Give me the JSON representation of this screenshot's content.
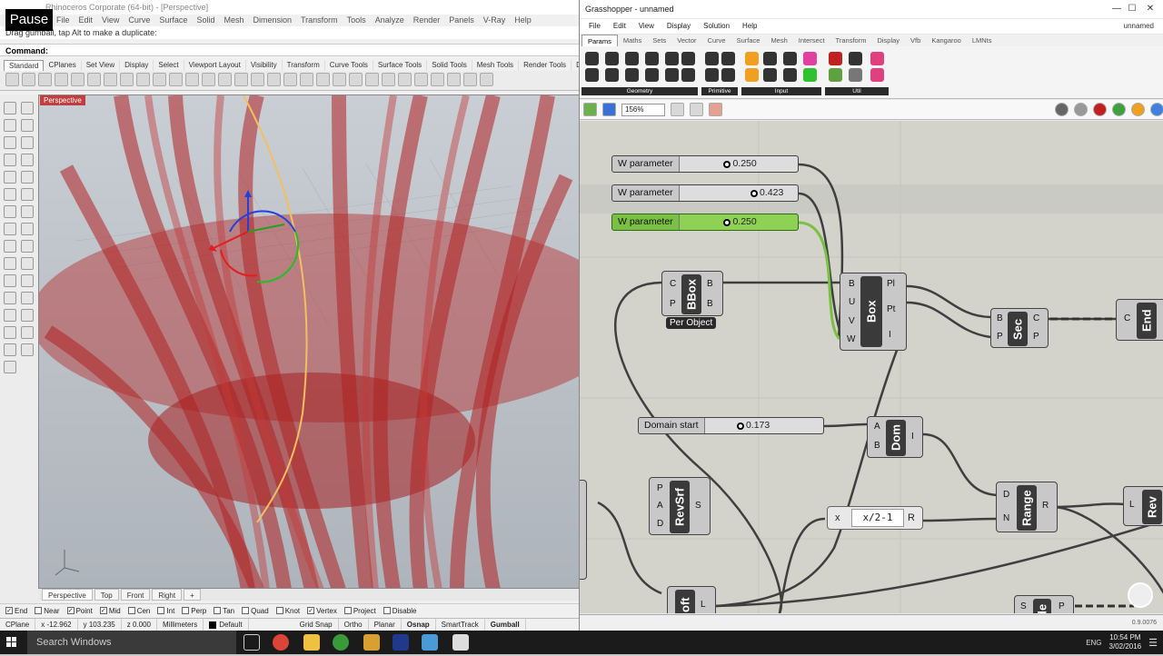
{
  "rhino": {
    "title": "Rhinoceros Corporate (64-bit) - [Perspective]",
    "pause_label": "Pause",
    "menu": [
      "File",
      "Edit",
      "View",
      "Curve",
      "Surface",
      "Solid",
      "Mesh",
      "Dimension",
      "Transform",
      "Tools",
      "Analyze",
      "Render",
      "Panels",
      "V-Ray",
      "Help"
    ],
    "prompt_text": "Drag gumball, tap Alt to make a duplicate:",
    "command_label": "Command:",
    "toolbar_tabs": [
      "Standard",
      "CPlanes",
      "Set View",
      "Display",
      "Select",
      "Viewport Layout",
      "Visibility",
      "Transform",
      "Curve Tools",
      "Surface Tools",
      "Solid Tools",
      "Mesh Tools",
      "Render Tools",
      "Drafting"
    ],
    "viewport_label": "Perspective",
    "viewport_tabs": [
      "Perspective",
      "Top",
      "Front",
      "Right",
      "+"
    ],
    "osnaps": [
      {
        "label": "End",
        "checked": true
      },
      {
        "label": "Near",
        "checked": false
      },
      {
        "label": "Point",
        "checked": true
      },
      {
        "label": "Mid",
        "checked": true
      },
      {
        "label": "Cen",
        "checked": false
      },
      {
        "label": "Int",
        "checked": false
      },
      {
        "label": "Perp",
        "checked": false
      },
      {
        "label": "Tan",
        "checked": false
      },
      {
        "label": "Quad",
        "checked": false
      },
      {
        "label": "Knot",
        "checked": false
      },
      {
        "label": "Vertex",
        "checked": true
      },
      {
        "label": "Project",
        "checked": false
      },
      {
        "label": "Disable",
        "checked": false
      }
    ],
    "status": {
      "cplane": "CPlane",
      "x": "x -12.962",
      "y": "y 103.235",
      "z": "z 0.000",
      "units": "Millimeters",
      "layer": "Default",
      "grid_snap": "Grid Snap",
      "ortho": "Ortho",
      "planar": "Planar",
      "osnap": "Osnap",
      "smarttrack": "SmartTrack",
      "gumball": "Gumball"
    }
  },
  "gh": {
    "title": "Grasshopper - unnamed",
    "doc_name": "unnamed",
    "menu": [
      "File",
      "Edit",
      "View",
      "Display",
      "Solution",
      "Help"
    ],
    "tabs": [
      "Params",
      "Maths",
      "Sets",
      "Vector",
      "Curve",
      "Surface",
      "Mesh",
      "Intersect",
      "Transform",
      "Display",
      "Vfb",
      "Kangaroo",
      "LMNts"
    ],
    "ribbon_groups": [
      "Geometry",
      "Primitive",
      "Input",
      "Util"
    ],
    "zoom": "156%",
    "version": "0.9.0076",
    "sliders": [
      {
        "label": "W parameter",
        "value": "0.250",
        "knob": 0.25,
        "selected": false
      },
      {
        "label": "W parameter",
        "value": "0.423",
        "knob": 0.423,
        "selected": false
      },
      {
        "label": "W parameter",
        "value": "0.250",
        "knob": 0.25,
        "selected": true
      },
      {
        "label": "Domain start",
        "value": "0.173",
        "knob": 0.173,
        "selected": false
      }
    ],
    "components": {
      "bbox": {
        "name": "BBox",
        "inputs": [
          "C",
          "P"
        ],
        "outputs": [
          "B",
          "B"
        ],
        "tag": "Per Object"
      },
      "box": {
        "name": "Box",
        "inputs": [
          "B",
          "U",
          "V",
          "W"
        ],
        "outputs": [
          "Pl",
          "Pt",
          "I"
        ]
      },
      "sec": {
        "name": "Sec",
        "inputs": [
          "B",
          "P"
        ],
        "outputs": [
          "C",
          "P"
        ]
      },
      "end": {
        "name": "End",
        "inputs": [
          "C"
        ]
      },
      "dom": {
        "name": "Dom",
        "inputs": [
          "A",
          "B"
        ],
        "outputs": [
          "I"
        ]
      },
      "revsrf": {
        "name": "RevSrf",
        "inputs": [
          "P",
          "A",
          "D"
        ],
        "outputs": [
          "S"
        ]
      },
      "range": {
        "name": "Range",
        "inputs": [
          "D",
          "N"
        ],
        "outputs": [
          "R"
        ]
      },
      "expr": {
        "input": "x",
        "formula": "x/2-1",
        "output": "R"
      },
      "rev": {
        "name": "Rev",
        "inputs": [
          "L"
        ]
      },
      "loft": {
        "name": "oft",
        "outputs": [
          "L"
        ]
      },
      "bottom_comp": {
        "name": "de",
        "inputs": [
          "S"
        ],
        "outputs": [
          "P"
        ]
      }
    }
  },
  "taskbar": {
    "search_placeholder": "Search Windows",
    "lang": "ENG",
    "time": "10:54 PM",
    "date": "3/02/2016"
  },
  "colors": {
    "gh_selected": "#7ac143",
    "rhino_red": "#b02020",
    "canvas_bg": "#d3d3cc"
  }
}
